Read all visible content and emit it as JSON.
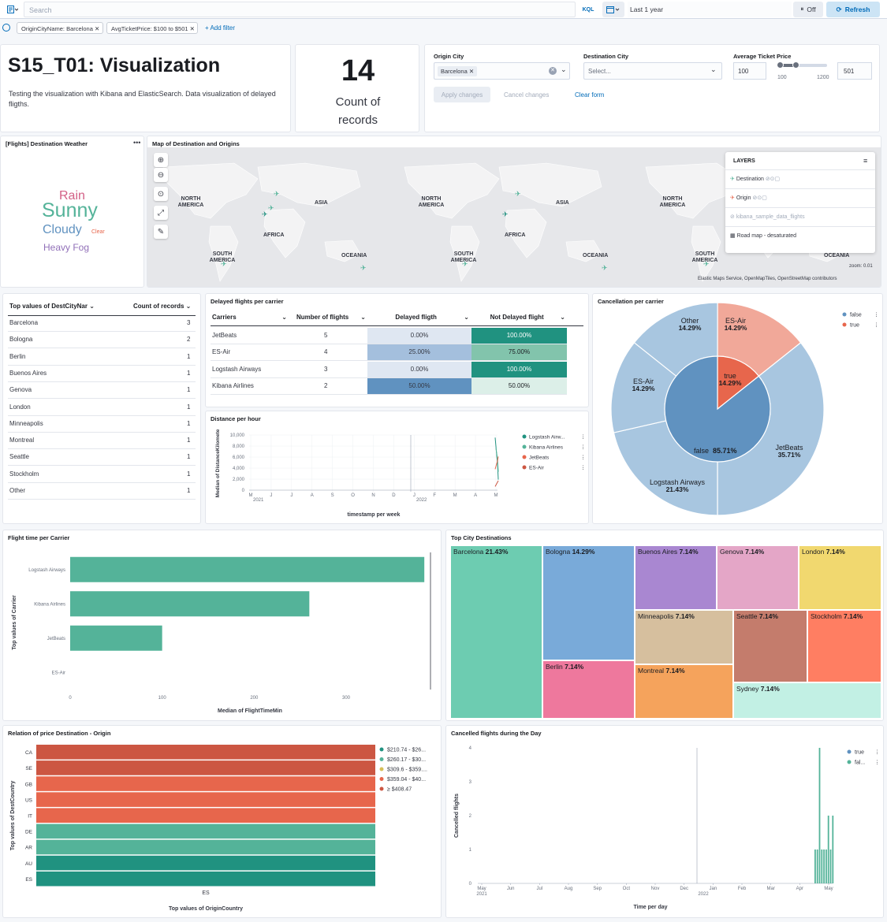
{
  "topbar": {
    "search_placeholder": "Search",
    "kql": "KQL",
    "time_range": "Last 1 year",
    "auto_refresh": "Off",
    "refresh": "Refresh"
  },
  "filters": {
    "pills": [
      "OriginCityName: Barcelona",
      "AvgTicketPrice: $100 to $501"
    ],
    "add": "+ Add filter"
  },
  "markdown": {
    "title": "S15_T01: Visualization",
    "body": "Testing the visualization with Kibana and ElasticSearch. Data visualization of delayed fligths."
  },
  "metric": {
    "value": "14",
    "label_line1": "Count of",
    "label_line2": "records"
  },
  "controls": {
    "origin_label": "Origin City",
    "origin_value": "Barcelona",
    "dest_label": "Destination City",
    "dest_placeholder": "Select...",
    "price_label": "Average Ticket Price",
    "price_min": "100",
    "price_max": "501",
    "range_min": "100",
    "range_max": "1200",
    "apply": "Apply changes",
    "cancel": "Cancel changes",
    "clear": "Clear form"
  },
  "weather": {
    "title": "[Flights] Destination Weather",
    "words": [
      "Rain",
      "Sunny",
      "Cloudy",
      "Clear",
      "Heavy Fog"
    ],
    "colors": [
      "#d36086",
      "#54b399",
      "#6092c0",
      "#e7664c",
      "#9170b8"
    ]
  },
  "map": {
    "title": "Map of Destination and Origins",
    "labels": [
      "NORTH AMERICA",
      "ASIA",
      "NORTH AMERICA",
      "ASIA",
      "NORTH AMERICA",
      "AFRICA",
      "AFRICA",
      "SOUTH AMERICA",
      "OCEANIA",
      "SOUTH AMERICA",
      "OCEANIA",
      "SOUTH AMERICA",
      "OCEANIA"
    ],
    "layers_title": "LAYERS",
    "layers": [
      "Destination",
      "Origin",
      "kibana_sample_data_flights",
      "Road map - desaturated"
    ],
    "attribution": "Elastic Maps Service, OpenMapTiles, OpenStreetMap contributors",
    "zoom": "zoom: 0.01"
  },
  "top_dest": {
    "col1": "Top values of DestCityNar",
    "col2": "Count of records",
    "rows": [
      {
        "city": "Barcelona",
        "count": "3"
      },
      {
        "city": "Bologna",
        "count": "2"
      },
      {
        "city": "Berlin",
        "count": "1"
      },
      {
        "city": "Buenos Aires",
        "count": "1"
      },
      {
        "city": "Genova",
        "count": "1"
      },
      {
        "city": "London",
        "count": "1"
      },
      {
        "city": "Minneapolis",
        "count": "1"
      },
      {
        "city": "Montreal",
        "count": "1"
      },
      {
        "city": "Seattle",
        "count": "1"
      },
      {
        "city": "Stockholm",
        "count": "1"
      },
      {
        "city": "Other",
        "count": "1"
      }
    ]
  },
  "delayed": {
    "title": "Delayed flights per carrier",
    "headers": [
      "Carriers",
      "Number of flights",
      "Delayed fligth",
      "Not Delayed flight"
    ],
    "rows": [
      {
        "carrier": "JetBeats",
        "n": "5",
        "delayed": "0.00%",
        "not": "100.00%"
      },
      {
        "carrier": "ES-Air",
        "n": "4",
        "delayed": "25.00%",
        "not": "75.00%"
      },
      {
        "carrier": "Logstash Airways",
        "n": "3",
        "delayed": "0.00%",
        "not": "100.00%"
      },
      {
        "carrier": "Kibana Airlines",
        "n": "2",
        "delayed": "50.00%",
        "not": "50.00%"
      }
    ]
  },
  "chart_data": [
    {
      "type": "line",
      "title": "Distance per hour",
      "xlabel": "timestamp per week",
      "ylabel": "Median of DistanceKilomete",
      "x_ticks": [
        "M",
        "J",
        "J",
        "A",
        "S",
        "O",
        "N",
        "D",
        "J",
        "F",
        "M",
        "A",
        "M"
      ],
      "x_year_ticks": [
        "2021",
        "2022"
      ],
      "y_ticks": [
        "10,000",
        "8,000",
        "6,000",
        "4,000",
        "2,000",
        "0"
      ],
      "ylim": [
        0,
        10500
      ],
      "series": [
        {
          "name": "Logstash Airw...",
          "color": "#209280"
        },
        {
          "name": "Kibana Airlines",
          "color": "#54b399"
        },
        {
          "name": "JetBeats",
          "color": "#e7664c"
        },
        {
          "name": "ES-Air",
          "color": "#cc5642"
        }
      ]
    },
    {
      "type": "pie",
      "title": "Cancellation per carrier",
      "legend": [
        "false",
        "true"
      ],
      "inner": [
        {
          "label": "false",
          "pct": 85.71,
          "text": "85.71%",
          "color": "#6092c0"
        },
        {
          "label": "true",
          "pct": 14.29,
          "text": "14.29%",
          "color": "#e7664c"
        }
      ],
      "outer": [
        {
          "label": "ES-Air",
          "pct": 14.29,
          "text": "14.29%",
          "color": "#f1a899"
        },
        {
          "label": "JetBeats",
          "pct": 35.71,
          "text": "35.71%",
          "color": "#a8c6e0"
        },
        {
          "label": "Logstash Airways",
          "pct": 21.43,
          "text": "21.43%",
          "color": "#a8c6e0"
        },
        {
          "label": "ES-Air",
          "pct": 14.29,
          "text": "14.29%",
          "color": "#a8c6e0"
        },
        {
          "label": "Other",
          "pct": 14.29,
          "text": "14.29%",
          "color": "#a8c6e0"
        }
      ]
    },
    {
      "type": "bar",
      "title": "Flight time per Carrier",
      "xlabel": "Median of FlightTimeMin",
      "ylabel": "Top values of Carrier",
      "categories": [
        "Logstash Airways",
        "Kibana Airlines",
        "JetBeats",
        "ES-Air"
      ],
      "values": [
        385,
        260,
        100,
        0
      ],
      "x_ticks": [
        0,
        100,
        200,
        300
      ],
      "xlim": [
        0,
        390
      ]
    },
    {
      "type": "heatmap",
      "title": "Top City Destinations",
      "cells": [
        {
          "label": "Barcelona",
          "pct": "21.43%",
          "color": "#6dccb1"
        },
        {
          "label": "Bologna",
          "pct": "14.29%",
          "color": "#79aad9"
        },
        {
          "label": "Buenos Aires",
          "pct": "7.14%",
          "color": "#a987d1"
        },
        {
          "label": "Genova",
          "pct": "7.14%",
          "color": "#e4a6c7"
        },
        {
          "label": "London",
          "pct": "7.14%",
          "color": "#f1d86f"
        },
        {
          "label": "Berlin",
          "pct": "7.14%",
          "color": "#ee789d"
        },
        {
          "label": "Minneapolis",
          "pct": "7.14%",
          "color": "#d6bf9e"
        },
        {
          "label": "Seattle",
          "pct": "7.14%",
          "color": "#c47c6c"
        },
        {
          "label": "Stockholm",
          "pct": "7.14%",
          "color": "#ff7e62"
        },
        {
          "label": "Montreal",
          "pct": "7.14%",
          "color": "#f5a35c"
        },
        {
          "label": "Sydney",
          "pct": "7.14%",
          "color": "#c2f0e4"
        }
      ]
    },
    {
      "type": "bar",
      "title": "Relation of price Destination - Origin",
      "xlabel": "Top values of OriginCountry",
      "ylabel": "Top values of DestCountry",
      "x_categories": [
        "ES"
      ],
      "categories": [
        "CA",
        "SE",
        "GB",
        "US",
        "IT",
        "DE",
        "AR",
        "AU",
        "ES"
      ],
      "colors": [
        "#cc5642",
        "#cc5642",
        "#e7664c",
        "#e7664c",
        "#e7664c",
        "#54b399",
        "#54b399",
        "#209280",
        "#209280"
      ],
      "legend": [
        {
          "label": "$210.74 - $26...",
          "color": "#209280"
        },
        {
          "label": "$260.17 - $30...",
          "color": "#54b399"
        },
        {
          "label": "$309.6 - $359....",
          "color": "#d6bf57"
        },
        {
          "label": "$359.04 - $40...",
          "color": "#e7664c"
        },
        {
          "label": "≥ $408.47",
          "color": "#cc5642"
        }
      ]
    },
    {
      "type": "bar",
      "title": "Cancelled flights during the Day",
      "xlabel": "Time per day",
      "ylabel": "Cancelled flights",
      "x_ticks": [
        "May",
        "Jun",
        "Jul",
        "Aug",
        "Sep",
        "Oct",
        "Nov",
        "Dec",
        "Jan",
        "Feb",
        "Mar",
        "Apr",
        "May"
      ],
      "x_year_ticks": [
        "2021",
        "2022"
      ],
      "y_ticks": [
        "4",
        "3",
        "2",
        "1",
        "0"
      ],
      "ylim": [
        0,
        4
      ],
      "values": [
        1,
        1,
        4,
        1,
        1,
        1,
        2,
        1,
        2
      ],
      "legend": [
        {
          "label": "true",
          "color": "#6092c0"
        },
        {
          "label": "fal...",
          "color": "#54b399"
        }
      ]
    }
  ]
}
